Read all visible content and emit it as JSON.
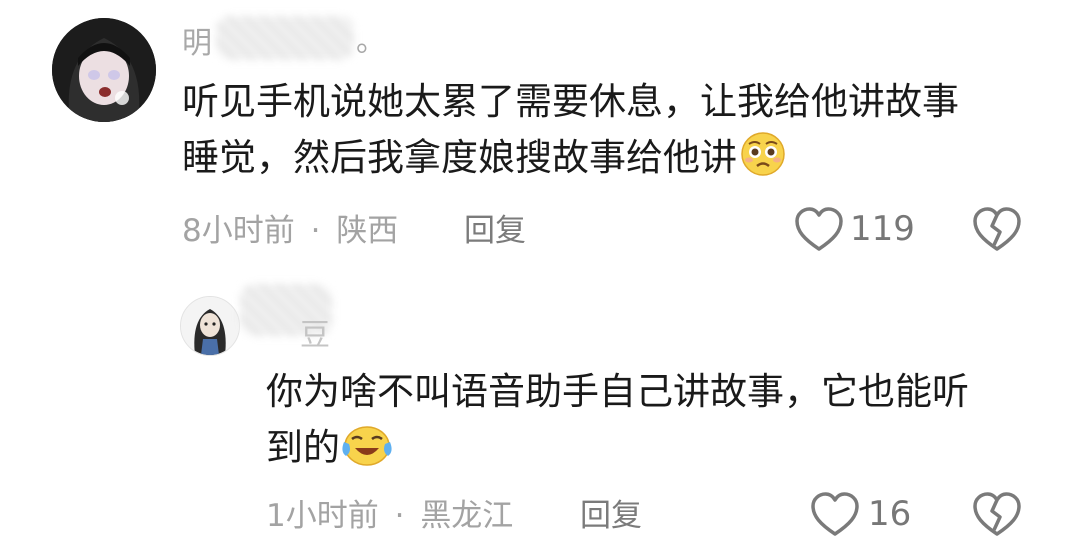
{
  "comments": [
    {
      "author_visible": "明",
      "author_suffix": "。",
      "text_line1": "听见手机说她太累了需要休息，让我给他讲故事",
      "text_line2": "睡觉，然后我拿度娘搜故事给他讲",
      "emoji": "pleading-face-icon",
      "time": "8小时前",
      "separator": "·",
      "location": "陕西",
      "reply_label": "回复",
      "likes": "119"
    },
    {
      "author_visible": "豆",
      "text_line1": "你为啥不叫语音助手自己讲故事，它也能听",
      "text_line2": "到的",
      "emoji": "laughing-crying-face-icon",
      "time": "1小时前",
      "separator": "·",
      "location": "黑龙江",
      "reply_label": "回复",
      "likes": "16"
    }
  ],
  "colors": {
    "text": "#1a1a1a",
    "meta": "#a3a3a3",
    "icon": "#7a7a7a"
  }
}
